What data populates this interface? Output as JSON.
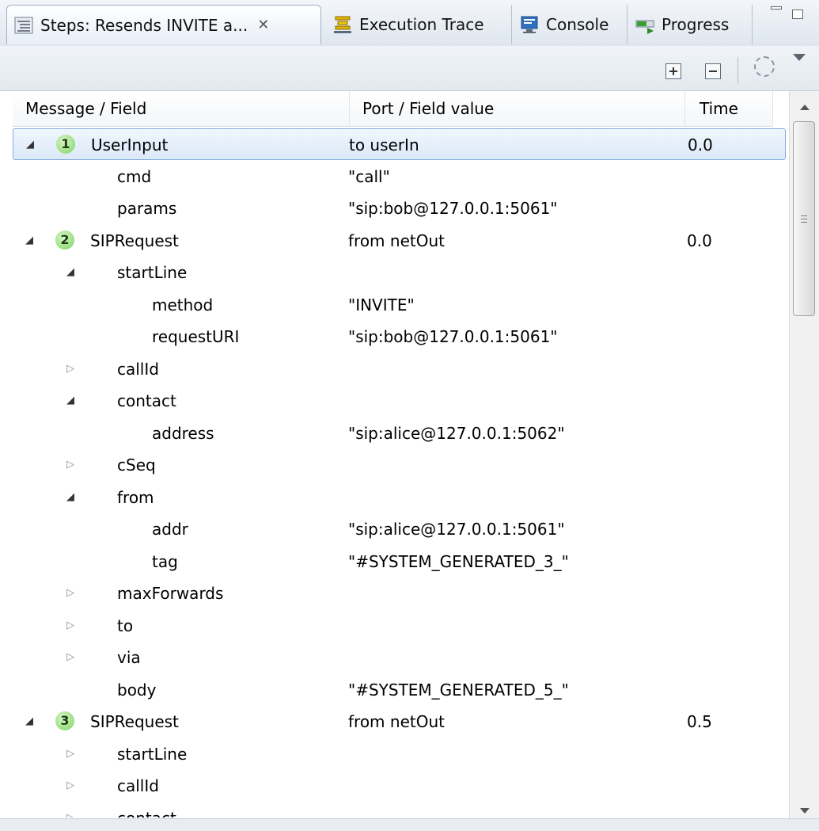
{
  "tabs": [
    {
      "label": "Steps: Resends INVITE a...",
      "icon": "steps-icon",
      "active": true,
      "closable": true,
      "close_glyph": "✕"
    },
    {
      "label": "Execution Trace",
      "icon": "execution-trace-icon",
      "active": false
    },
    {
      "label": "Console",
      "icon": "console-icon",
      "active": false
    },
    {
      "label": "Progress",
      "icon": "progress-icon",
      "active": false
    }
  ],
  "toolbar": {
    "expand_all_icon": "expand-all-icon",
    "collapse_all_icon": "collapse-all-icon",
    "busy_icon": "busy-indicator-icon",
    "view_menu_icon": "view-menu-icon"
  },
  "table": {
    "columns": [
      "Message / Field",
      "Port / Field value",
      "Time"
    ],
    "rows": [
      {
        "indent": 0,
        "expander": "expanded",
        "badge": "1",
        "name": "UserInput",
        "value": "to userIn",
        "time": "0.0",
        "selected": true
      },
      {
        "indent": 1,
        "expander": "none",
        "name": "cmd",
        "value": "\"call\"",
        "time": ""
      },
      {
        "indent": 1,
        "expander": "none",
        "name": "params",
        "value": "\"sip:bob@127.0.0.1:5061\"",
        "time": ""
      },
      {
        "indent": 0,
        "expander": "expanded",
        "badge": "2",
        "name": "SIPRequest",
        "value": "from netOut",
        "time": "0.0"
      },
      {
        "indent": 1,
        "expander": "expanded",
        "name": "startLine",
        "value": "",
        "time": ""
      },
      {
        "indent": 2,
        "expander": "none",
        "name": "method",
        "value": "\"INVITE\"",
        "time": ""
      },
      {
        "indent": 2,
        "expander": "none",
        "name": "requestURI",
        "value": "\"sip:bob@127.0.0.1:5061\"",
        "time": ""
      },
      {
        "indent": 1,
        "expander": "collapsed",
        "name": "callId",
        "value": "",
        "time": ""
      },
      {
        "indent": 1,
        "expander": "expanded",
        "name": "contact",
        "value": "",
        "time": ""
      },
      {
        "indent": 2,
        "expander": "none",
        "name": "address",
        "value": "\"sip:alice@127.0.0.1:5062\"",
        "time": ""
      },
      {
        "indent": 1,
        "expander": "collapsed",
        "name": "cSeq",
        "value": "",
        "time": ""
      },
      {
        "indent": 1,
        "expander": "expanded",
        "name": "from",
        "value": "",
        "time": ""
      },
      {
        "indent": 2,
        "expander": "none",
        "name": "addr",
        "value": "\"sip:alice@127.0.0.1:5061\"",
        "time": ""
      },
      {
        "indent": 2,
        "expander": "none",
        "name": "tag",
        "value": "\"#SYSTEM_GENERATED_3_\"",
        "time": ""
      },
      {
        "indent": 1,
        "expander": "collapsed",
        "name": "maxForwards",
        "value": "",
        "time": ""
      },
      {
        "indent": 1,
        "expander": "collapsed",
        "name": "to",
        "value": "",
        "time": ""
      },
      {
        "indent": 1,
        "expander": "collapsed",
        "name": "via",
        "value": "",
        "time": ""
      },
      {
        "indent": 1,
        "expander": "none",
        "name": "body",
        "value": "\"#SYSTEM_GENERATED_5_\"",
        "time": ""
      },
      {
        "indent": 0,
        "expander": "expanded",
        "badge": "3",
        "name": "SIPRequest",
        "value": "from netOut",
        "time": "0.5"
      },
      {
        "indent": 1,
        "expander": "collapsed",
        "name": "startLine",
        "value": "",
        "time": ""
      },
      {
        "indent": 1,
        "expander": "collapsed",
        "name": "callId",
        "value": "",
        "time": ""
      },
      {
        "indent": 1,
        "expander": "collapsed",
        "name": "contact",
        "value": "",
        "time": ""
      }
    ]
  },
  "colors": {
    "selection_border": "#84acdd",
    "badge_green": "#7fd25f"
  },
  "glyphs": {
    "expanded": "◢",
    "collapsed": "▷"
  }
}
